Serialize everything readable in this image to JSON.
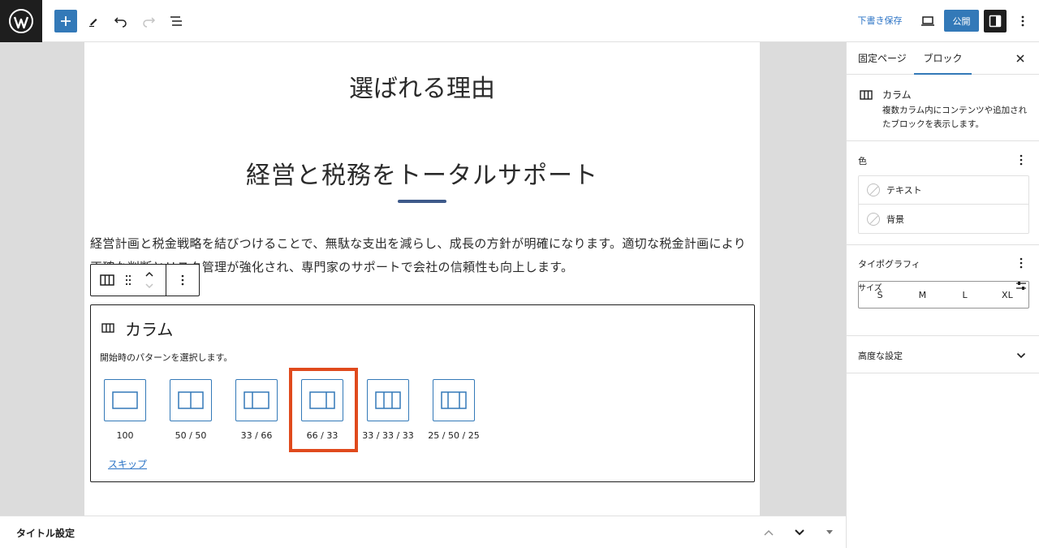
{
  "toolbar": {
    "draft_label": "下書き保存",
    "publish_label": "公開"
  },
  "content": {
    "heading1": "選ばれる理由",
    "heading2": "経営と税務をトータルサポート",
    "paragraph": "経営計画と税金戦略を結びつけることで、無駄な支出を減らし、成長の方針が明確になります。適切な税金計画により正確な判断とリスク管理が強化され、専門家のサポートで会社の信頼性も向上します。"
  },
  "columns_placeholder": {
    "title": "カラム",
    "instructions": "開始時のパターンを選択します。",
    "variations": [
      {
        "label": "100",
        "icon": "columns-100-icon"
      },
      {
        "label": "50 / 50",
        "icon": "columns-50-50-icon"
      },
      {
        "label": "33 / 66",
        "icon": "columns-33-66-icon"
      },
      {
        "label": "66 / 33",
        "icon": "columns-66-33-icon"
      },
      {
        "label": "33 / 33 / 33",
        "icon": "columns-33-33-33-icon"
      },
      {
        "label": "25 / 50 / 25",
        "icon": "columns-25-50-25-icon"
      }
    ],
    "skip_label": "スキップ",
    "highlighted_variation": "66 / 33",
    "highlight_color": "#e04a1d"
  },
  "footer": {
    "title": "タイトル設定"
  },
  "sidebar": {
    "tabs": [
      {
        "label": "固定ページ",
        "active": false
      },
      {
        "label": "ブロック",
        "active": true
      }
    ],
    "block_card": {
      "title": "カラム",
      "description": "複数カラム内にコンテンツや追加されたブロックを表示します。"
    },
    "color": {
      "title": "色",
      "items": [
        "テキスト",
        "背景"
      ]
    },
    "typography": {
      "title": "タイポグラフィ",
      "size_label": "サイズ",
      "sizes": [
        "S",
        "M",
        "L",
        "XL"
      ]
    },
    "advanced": {
      "title": "高度な設定"
    }
  },
  "colors": {
    "accent": "#3379b8",
    "heading_underline": "#3e5a8a"
  }
}
